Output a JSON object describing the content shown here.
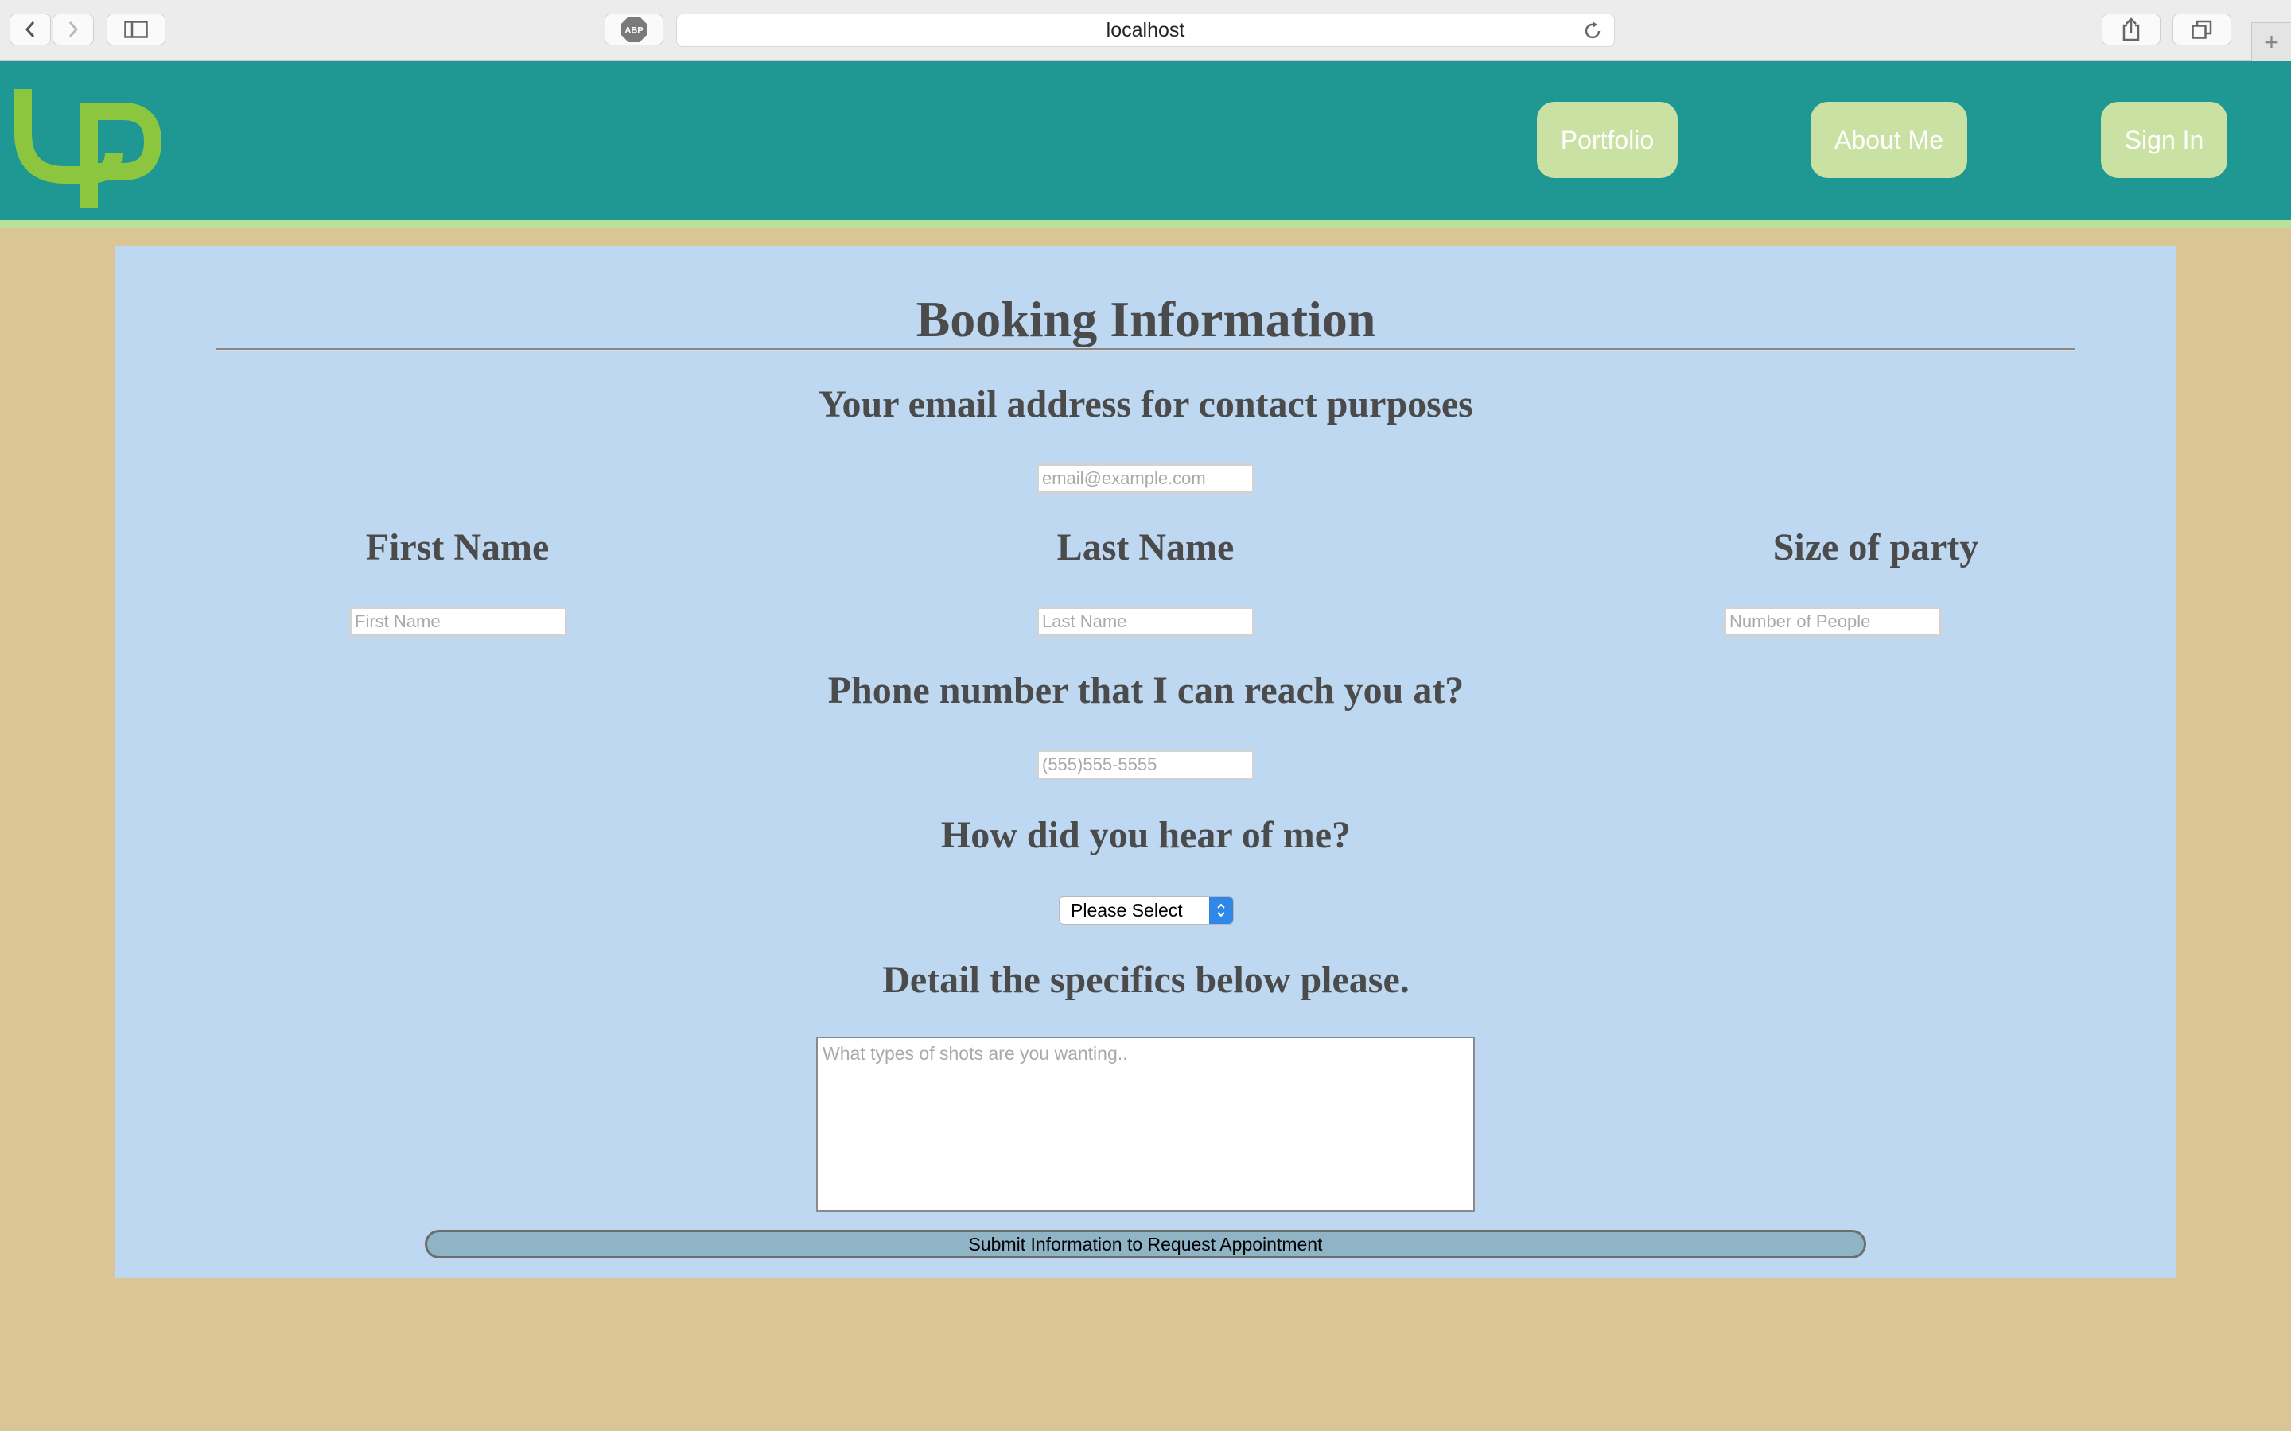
{
  "browser": {
    "url": "localhost",
    "adblock_label": "ABP",
    "new_tab_symbol": "+"
  },
  "header": {
    "logo_icon": "lp-logo",
    "nav": [
      {
        "label": "Portfolio"
      },
      {
        "label": "About Me"
      },
      {
        "label": "Sign In"
      }
    ]
  },
  "form": {
    "title": "Booking Information",
    "email": {
      "heading": "Your email address for contact purposes",
      "placeholder": "email@example.com",
      "value": ""
    },
    "first_name": {
      "heading": "First Name",
      "placeholder": "First Name",
      "value": ""
    },
    "last_name": {
      "heading": "Last Name",
      "placeholder": "Last Name",
      "value": ""
    },
    "party_size": {
      "heading": "Size of party",
      "placeholder": "Number of People",
      "value": ""
    },
    "phone": {
      "heading": "Phone number that I can reach you at?",
      "placeholder": "(555)555-5555",
      "value": ""
    },
    "referral": {
      "heading": "How did you hear of me?",
      "selected": "Please Select"
    },
    "details": {
      "heading": "Detail the specifics below please.",
      "placeholder": "What types of shots are you wanting.."
    },
    "submit_label": "Submit Information to Request Appointment"
  },
  "colors": {
    "page_bg": "#dac596",
    "header_bg": "#1f9793",
    "nav_button_bg": "#c9e1a2",
    "panel_bg": "#bfd8f2",
    "logo_green": "#8cc63f"
  }
}
